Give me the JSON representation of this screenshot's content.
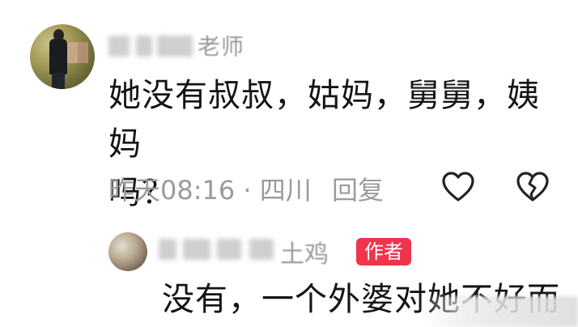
{
  "comment": {
    "username_visible_tail": "老师",
    "text_line1": "她没有叔叔，姑妈，舅舅，姨妈",
    "text_line2": "吗？",
    "meta": "昨天08:16 · 四川",
    "reply_label": "回复",
    "like_icon": "heart-outline-icon",
    "dislike_icon": "broken-heart-icon"
  },
  "reply": {
    "username_visible_tail": "土鸡",
    "author_badge": "作者",
    "text": "没有，一个外婆对她不好而"
  },
  "colors": {
    "text": "#141414",
    "meta": "#9b9b9b",
    "badge_bg": "#f0344c",
    "badge_text": "#ffffff"
  }
}
